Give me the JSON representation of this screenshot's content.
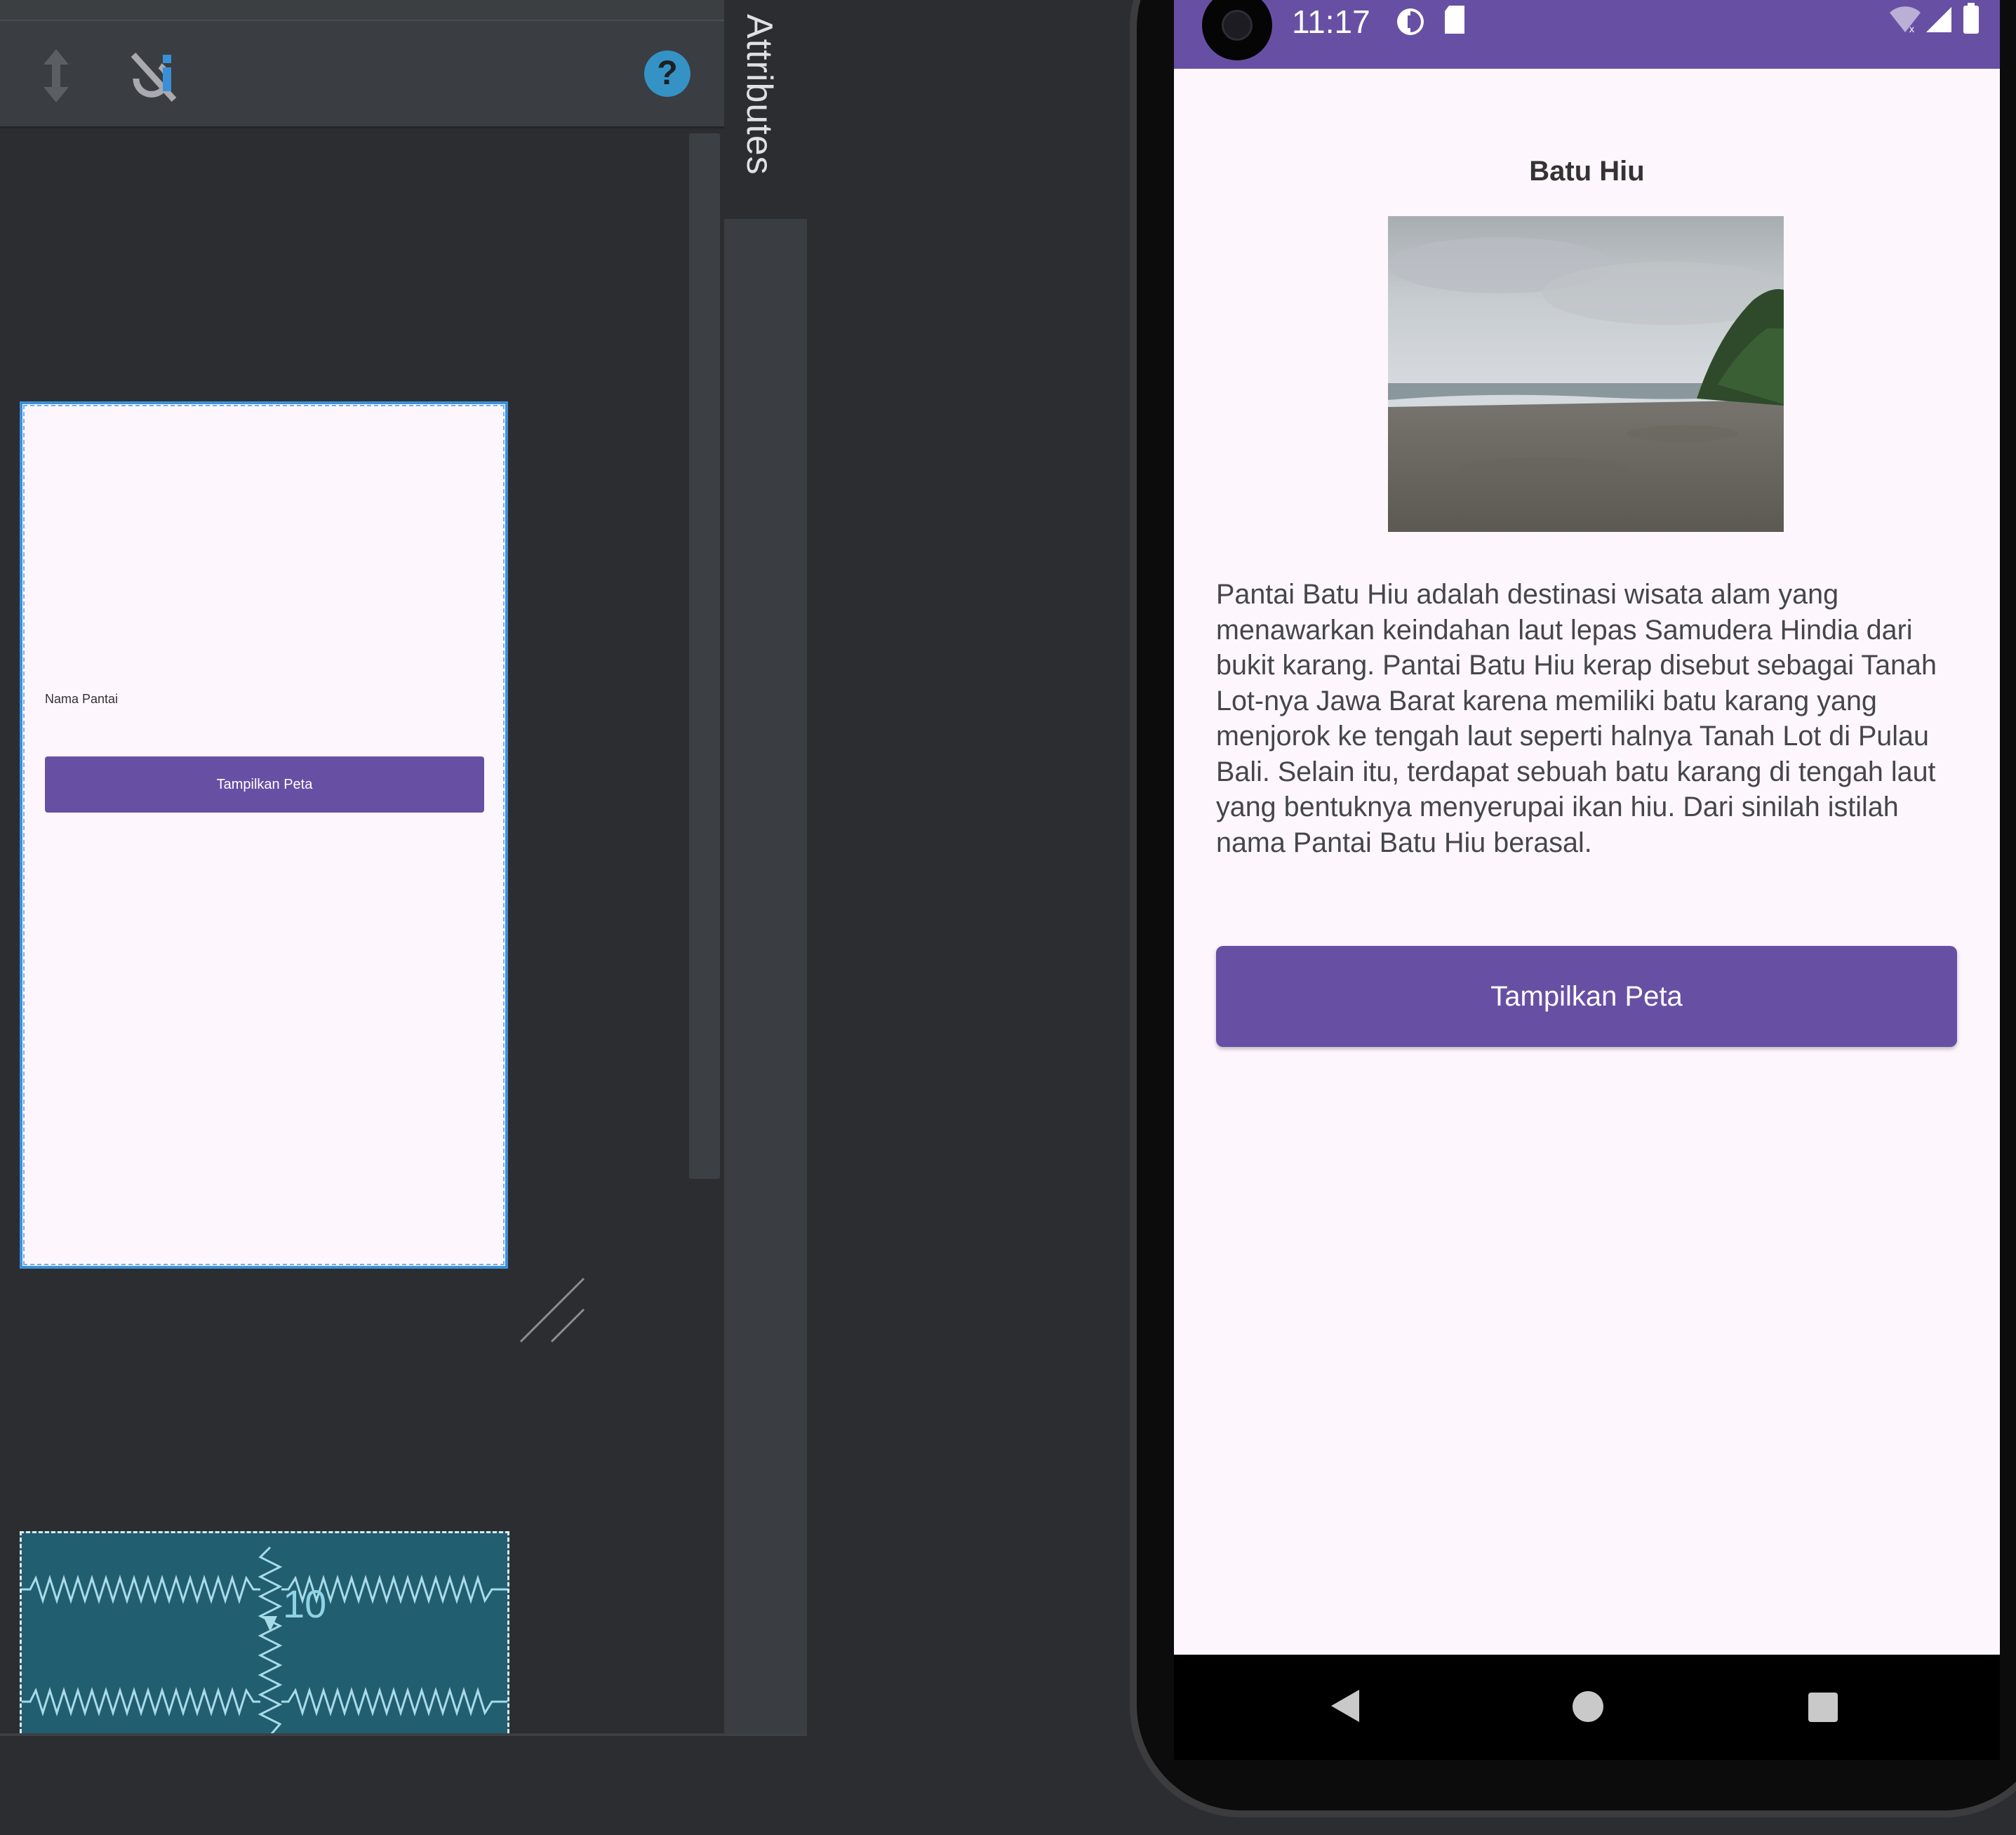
{
  "ide": {
    "attributes_tab_label": "Attributes",
    "help_icon_glyph": "?",
    "design_preview": {
      "label_text": "Nama Pantai",
      "button_label": "Tampilkan Peta"
    },
    "blueprint": {
      "margin_label": "10"
    }
  },
  "phone": {
    "status_bar": {
      "time": "11:17"
    },
    "screen": {
      "title": "Batu Hiu",
      "image_alt": "beach-photo",
      "description": "Pantai Batu Hiu adalah destinasi wisata alam yang menawarkan keindahan laut lepas Samudera Hindia dari bukit karang. Pantai Batu Hiu kerap disebut sebagai Tanah Lot-nya Jawa Barat karena memiliki batu karang yang menjorok ke tengah laut seperti halnya Tanah Lot di Pulau Bali. Selain itu, terdapat sebuah batu karang di tengah laut yang bentuknya menyerupai ikan hiu. Dari sinilah istilah nama Pantai Batu Hiu berasal.",
      "button_label": "Tampilkan Peta"
    }
  },
  "colors": {
    "accent": "#6750a4",
    "screen_background": "#fdf7fd",
    "ide_background": "#2b2d30",
    "selection_blue": "#3d8fd8",
    "help_blue": "#3592c4",
    "blueprint_teal": "#215e70"
  }
}
